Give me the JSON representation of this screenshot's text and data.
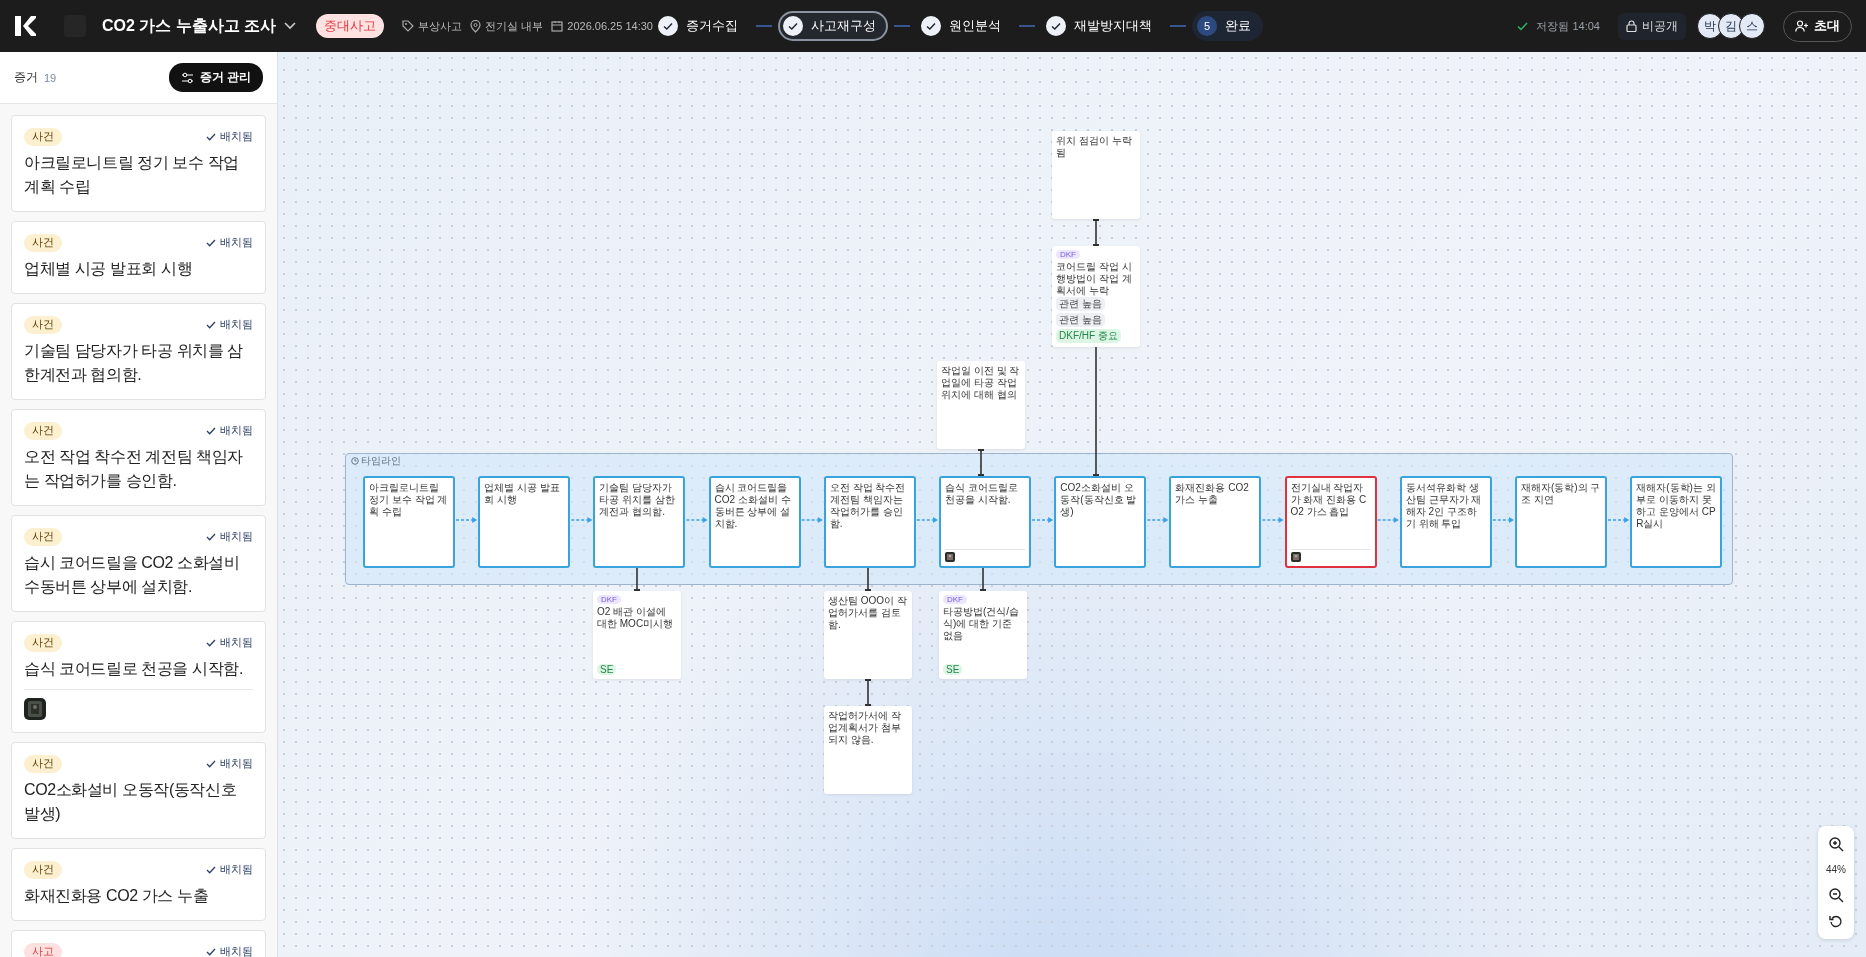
{
  "header": {
    "title": "CO2 가스 누출사고 조사",
    "severity": "중대사고",
    "category": "부상사고",
    "location": "전기실 내부",
    "datetime": "2026.06.25 14:30",
    "steps": [
      {
        "label": "증거수집",
        "kind": "done",
        "selected": false
      },
      {
        "label": "사고재구성",
        "kind": "done",
        "selected": true
      },
      {
        "label": "원인분석",
        "kind": "done",
        "selected": false
      },
      {
        "label": "재발방지대책",
        "kind": "done",
        "selected": false
      },
      {
        "label": "완료",
        "kind": "number",
        "number": "5",
        "selected": false
      }
    ],
    "save_status": "저장됨 14:04",
    "visibility": "비공개",
    "avatars": [
      "박",
      "김",
      "스"
    ],
    "invite": "초대"
  },
  "sidebar": {
    "title": "증거",
    "count": "19",
    "manage_button": "증거 관리",
    "cards": [
      {
        "color": "#fdf0d0",
        "badge": "사건",
        "status": "배치됨",
        "title": "아크릴로니트릴 정기 보수 작업 계획 수립",
        "photo": false
      },
      {
        "color": "#fdf0d0",
        "badge": "사건",
        "status": "배치됨",
        "title": "업체별 시공 발표회 시행",
        "photo": false
      },
      {
        "color": "#fdf0d0",
        "badge": "사건",
        "status": "배치됨",
        "title": "기술팀 담당자가 타공 위치를 삼한계전과 협의함.",
        "photo": false
      },
      {
        "color": "#fdf0d0",
        "badge": "사건",
        "status": "배치됨",
        "title": "오전 작업 착수전 계전팀 책임자는 작업허가를 승인함.",
        "photo": false
      },
      {
        "color": "#fdf0d0",
        "badge": "사건",
        "status": "배치됨",
        "title": "습시 코어드릴을 CO2 소화설비 수동버튼 상부에 설치함.",
        "photo": false
      },
      {
        "color": "#fdf0d0",
        "badge": "사건",
        "status": "배치됨",
        "title": "습식 코어드릴로 천공을 시작함.",
        "photo": true
      },
      {
        "color": "#fdf0d0",
        "badge": "사건",
        "status": "배치됨",
        "title": "CO2소화설비 오동작(동작신호 발생)",
        "photo": false
      },
      {
        "color": "#fdf0d0",
        "badge": "사건",
        "status": "배치됨",
        "title": "화재진화용 CO2 가스 누출",
        "photo": false
      },
      {
        "color": "#fde0e0",
        "badge": "사고",
        "status": "배치됨"
      }
    ]
  },
  "canvas": {
    "group_label": "타임라인",
    "timeline": [
      {
        "text": "아크릴로니트릴 정기 보수 작업 계획 수립",
        "flagged": false,
        "photo": false
      },
      {
        "text": "업체별 시공 발표회 시행",
        "flagged": false,
        "photo": false
      },
      {
        "text": "기술팀 담당자가 타공 위치를 삼한계전과 협의함.",
        "flagged": false,
        "photo": false
      },
      {
        "text": "습시 코어드릴을 CO2 소화설비 수동버튼 상부에 설치함.",
        "flagged": false,
        "photo": false
      },
      {
        "text": "오전 작업 착수전 계전팀 책임자는 작업허가를 승인함.",
        "flagged": false,
        "photo": false
      },
      {
        "text": "습식 코어드릴로 천공을 시작함.",
        "flagged": false,
        "photo": true
      },
      {
        "text": "CO2소화설비 오동작(동작신호 발생)",
        "flagged": false,
        "photo": false
      },
      {
        "text": "화재진화용 CO2 가스 누출",
        "flagged": false,
        "photo": false
      },
      {
        "text": "전기실내 작업자가 화재 진화용 CO2 가스 흡입",
        "flagged": true,
        "photo": true
      },
      {
        "text": "동서석유화학 생산팀 근무자가 재해자 2인 구조하기 위해 투입",
        "flagged": false,
        "photo": false
      },
      {
        "text": "재해자(동학)의 구조 지연",
        "flagged": false,
        "photo": false
      },
      {
        "text": "재해자(동학)는 외부로 이동하지 못하고 운양에서 CPR실시",
        "flagged": false,
        "photo": false
      }
    ],
    "factors": [
      {
        "text": "위치 점검이 누락됨"
      },
      {
        "tag": "DKF",
        "text": "코어드릴 작업 시행방법이 작업 계획서에 누락",
        "chips": [
          {
            "label": "관련 높음",
            "kind": "neutral"
          },
          {
            "label": "관련 높음",
            "kind": "neutral"
          },
          {
            "label": "DKF/HF 중요",
            "kind": "green"
          }
        ]
      },
      {
        "text": "작업일 이전 및 작업일에 타공 작업 위치에 대해 협의"
      },
      {
        "tag": "DKF",
        "text": "O2 배관 이설에 대한 MOC미시행",
        "chips": [
          {
            "label": "SE",
            "kind": "green"
          }
        ]
      },
      {
        "text": "생산팀 OOO이 작업허가서를 검토함."
      },
      {
        "tag": "DKF",
        "text": "타공방법(건식/습식)에 대한 기준 없음",
        "chips": [
          {
            "label": "SE",
            "kind": "green"
          }
        ]
      },
      {
        "text": "작업허가서에 작업계획서가 첨부되지 않음."
      }
    ],
    "zoom": "44%"
  }
}
